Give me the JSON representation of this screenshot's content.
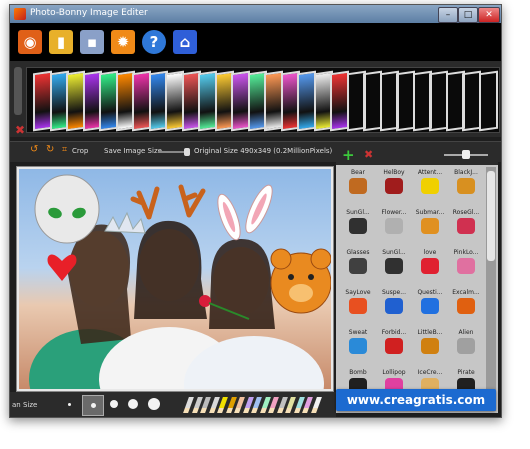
{
  "window": {
    "title": "Photo-Bonny Image Editer"
  },
  "toolbar": {
    "buttons": [
      {
        "name": "open-image-button",
        "icon": "camera-icon",
        "color": "#e06018"
      },
      {
        "name": "open-folder-button",
        "icon": "folder-icon",
        "color": "#e8b02a"
      },
      {
        "name": "save-button",
        "icon": "floppy-icon",
        "color": "#8aa0c8"
      },
      {
        "name": "settings-button",
        "icon": "gear-icon",
        "color": "#f08a18"
      },
      {
        "name": "help-button",
        "icon": "question-icon",
        "color": "#2f78d8"
      },
      {
        "name": "home-button",
        "icon": "home-icon",
        "color": "#2f5fd8"
      }
    ]
  },
  "options": {
    "crop_label": "Crop",
    "save_size_label": "Save Image Size",
    "original_size_label": "Original Size 490x349 (0.2MillionPixels)"
  },
  "bottom": {
    "pen_size_label": "an Size"
  },
  "stickers": [
    {
      "label": "Bear",
      "color": "#c06a20"
    },
    {
      "label": "HelBoy",
      "color": "#a01c1c"
    },
    {
      "label": "Attent...",
      "color": "#f0d000"
    },
    {
      "label": "BlackJ...",
      "color": "#d89020"
    },
    {
      "label": "SunGl...",
      "color": "#303030"
    },
    {
      "label": "Flower...",
      "color": "#b0b0b0"
    },
    {
      "label": "Submar...",
      "color": "#e09020"
    },
    {
      "label": "RoseGl...",
      "color": "#d03050"
    },
    {
      "label": "Glasses",
      "color": "#404040"
    },
    {
      "label": "SunGl...",
      "color": "#303030"
    },
    {
      "label": "love",
      "color": "#e02030"
    },
    {
      "label": "PinkLo...",
      "color": "#e070a0"
    },
    {
      "label": "SayLove",
      "color": "#e85020"
    },
    {
      "label": "Suspe...",
      "color": "#2060d0"
    },
    {
      "label": "Questi...",
      "color": "#2070e0"
    },
    {
      "label": "Excalm...",
      "color": "#e06010"
    },
    {
      "label": "Sweat",
      "color": "#2a8ad8"
    },
    {
      "label": "Forbid...",
      "color": "#d02020"
    },
    {
      "label": "LittleB...",
      "color": "#d08010"
    },
    {
      "label": "Alien",
      "color": "#a0a0a0"
    },
    {
      "label": "Bomb",
      "color": "#202020"
    },
    {
      "label": "Lollipop",
      "color": "#e040a0"
    },
    {
      "label": "IceCre...",
      "color": "#e0b060"
    },
    {
      "label": "Pirate",
      "color": "#202020"
    }
  ],
  "watermark": "www.creagratis.com"
}
